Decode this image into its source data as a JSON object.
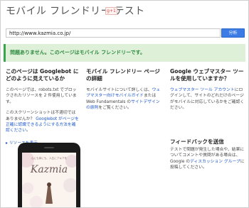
{
  "page": {
    "title": "モバイル フレンドリー テスト",
    "gplus_label": "g+1"
  },
  "search": {
    "url_value": "http://www.kazmia.co.jp/",
    "analyze_label": "分析"
  },
  "result": {
    "message": "問題ありません。このページはモバイル フレンドリーです。"
  },
  "col1": {
    "heading": "このページは Googlebot にどのように見えているか",
    "para1": "このページでは、robots.txt でブロックされたリソースを 2 件使用しています。",
    "para2_start": "このスクリーンショットは不適切ではありませんか？ ",
    "para2_link": "Googlebot がページを正確に認識できるようにする方法を確認ください",
    "para2_end": "。",
    "show_resources": "▸ リソースを表示"
  },
  "col2": {
    "heading": "モバイル フレンドリー ページの詳細",
    "text_a": "モバイルサイトについて詳しくは、",
    "link_a": "ウェブマスター向けモバイルガイド",
    "text_b": "または Web Fundamentals の",
    "link_b": "サイトデザインの原則",
    "text_c": "をご覧ください。"
  },
  "col3": {
    "heading": "Google ウェブマスター ツールを使用していますか？",
    "link_a": "ウェブマスター ツール アカウント",
    "text_a": "にログインして、サイトのどれだけのページがモバイルに対応しているかをご確認ください。",
    "feedback_title": "フィードバックを送信",
    "feedback_text": "テストで問題が発生した場合や、結果についてコメントや質問がある場合は、Google の",
    "feedback_link": "ディスカッション グループ",
    "feedback_end": "に投稿してください。"
  },
  "preview": {
    "tagline": "心にも体にも、人生にアキアを",
    "logo": "Kazmia"
  }
}
